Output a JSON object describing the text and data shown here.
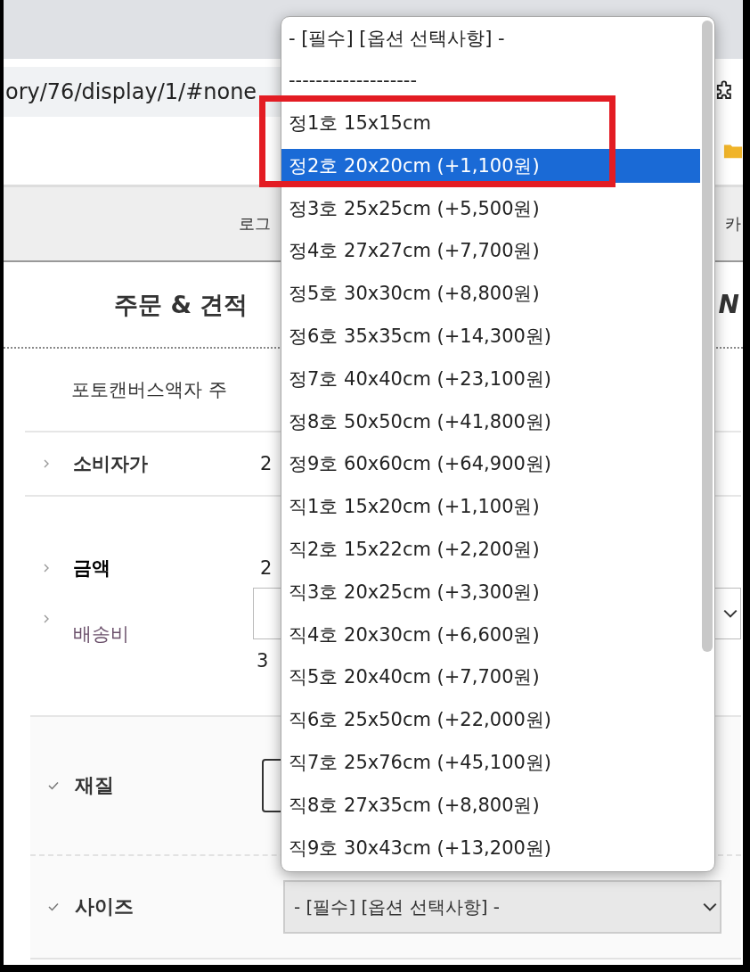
{
  "browser": {
    "url": "ory/76/display/1/#none"
  },
  "nav": {
    "items": [
      "로그",
      "카"
    ]
  },
  "header": {
    "title": "주문 & 견적",
    "right_text": "N"
  },
  "product_name": "포토캔버스액자 주",
  "price_rows": [
    {
      "kind": "price",
      "label": "소비자가",
      "value": "2"
    },
    {
      "kind": "total",
      "label": "금액",
      "value": "2"
    },
    {
      "kind": "shipping",
      "label": "배송비",
      "value": "3"
    }
  ],
  "options": [
    {
      "label": "재질",
      "kind": "button"
    },
    {
      "label": "사이즈",
      "kind": "select",
      "value": "- [필수] [옵션 선택사항] -"
    }
  ],
  "dropdown": {
    "items": [
      {
        "label": "- [필수] [옵션 선택사항] -",
        "selected": false
      },
      {
        "label": "-------------------",
        "selected": false
      },
      {
        "label": "정1호 15x15cm",
        "selected": false
      },
      {
        "label": "정2호 20x20cm (+1,100원)",
        "selected": true
      },
      {
        "label": "정3호 25x25cm (+5,500원)",
        "selected": false
      },
      {
        "label": "정4호 27x27cm (+7,700원)",
        "selected": false
      },
      {
        "label": "정5호 30x30cm (+8,800원)",
        "selected": false
      },
      {
        "label": "정6호 35x35cm (+14,300원)",
        "selected": false
      },
      {
        "label": "정7호 40x40cm (+23,100원)",
        "selected": false
      },
      {
        "label": "정8호 50x50cm (+41,800원)",
        "selected": false
      },
      {
        "label": "정9호 60x60cm (+64,900원)",
        "selected": false
      },
      {
        "label": "직1호 15x20cm (+1,100원)",
        "selected": false
      },
      {
        "label": "직2호 15x22cm (+2,200원)",
        "selected": false
      },
      {
        "label": "직3호 20x25cm (+3,300원)",
        "selected": false
      },
      {
        "label": "직4호 20x30cm (+6,600원)",
        "selected": false
      },
      {
        "label": "직5호 20x40cm (+7,700원)",
        "selected": false
      },
      {
        "label": "직6호 25x50cm (+22,000원)",
        "selected": false
      },
      {
        "label": "직7호 25x76cm (+45,100원)",
        "selected": false
      },
      {
        "label": "직8호 27x35cm (+8,800원)",
        "selected": false
      },
      {
        "label": "직9호 30x43cm (+13,200원)",
        "selected": false
      }
    ]
  }
}
